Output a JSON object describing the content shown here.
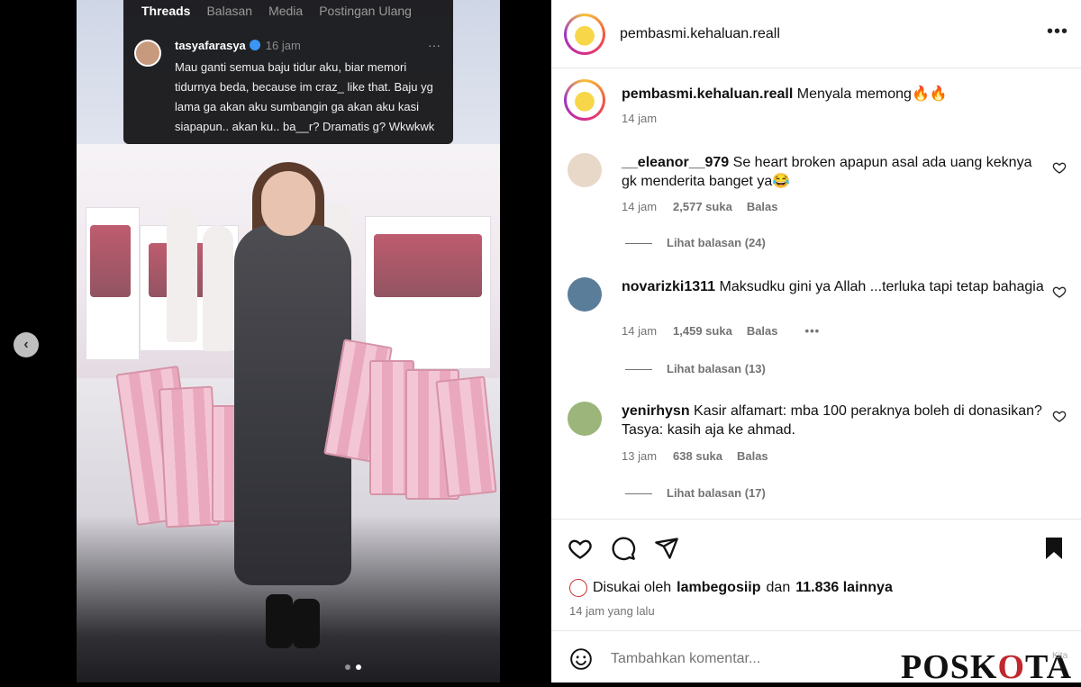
{
  "photo": {
    "threads": {
      "tabs": [
        "Threads",
        "Balasan",
        "Media",
        "Postingan Ulang"
      ],
      "username": "tasyafarasya",
      "time": "16 jam",
      "more": "···",
      "text": "Mau ganti semua baju tidur aku, biar memori tidurnya beda, because im craz_ like that. Baju yg lama ga akan aku sumbangin ga akan aku kasi siapapun.. akan ku.. ba__r? Dramatis g? Wkwkwk"
    },
    "nav_prev": "‹",
    "carousel_count": 2,
    "carousel_active": 1
  },
  "header": {
    "username": "pembasmi.kehaluan.reall",
    "more": "•••"
  },
  "caption": {
    "username": "pembasmi.kehaluan.reall",
    "text": "Menyala memong🔥🔥",
    "time": "14 jam"
  },
  "comments": [
    {
      "username": "__eleanor__979",
      "text": "Se heart broken apapun asal ada uang keknya gk menderita banget ya😂",
      "time": "14 jam",
      "likes": "2,577 suka",
      "reply": "Balas",
      "view_replies": "Lihat balasan (24)",
      "avatar_color": "#e8d8c8"
    },
    {
      "username": "novarizki1311",
      "text": "Maksudku gini ya Allah ...terluka tapi tetap bahagia",
      "time": "14 jam",
      "likes": "1,459 suka",
      "reply": "Balas",
      "more": "•••",
      "view_replies": "Lihat balasan (13)",
      "avatar_color": "#5a7d9a"
    },
    {
      "username": "yenirhysn",
      "text": "Kasir alfamart: mba 100 peraknya boleh di donasikan? Tasya: kasih aja ke ahmad.",
      "time": "13 jam",
      "likes": "638 suka",
      "reply": "Balas",
      "view_replies": "Lihat balasan (17)",
      "avatar_color": "#9bb57a"
    }
  ],
  "actions": {
    "liked_by_prefix": "Disukai oleh",
    "liked_by_user": "lambegosiip",
    "liked_by_and": "dan",
    "liked_by_count": "11.836 lainnya",
    "time_ago": "14 jam yang lalu"
  },
  "add_comment": {
    "placeholder": "Tambahkan komentar..."
  },
  "watermark": {
    "p": "P",
    "o1": "O",
    "s": "S",
    "k": "K",
    "o2": "O",
    "ta": "TA",
    "small": "Kita"
  }
}
